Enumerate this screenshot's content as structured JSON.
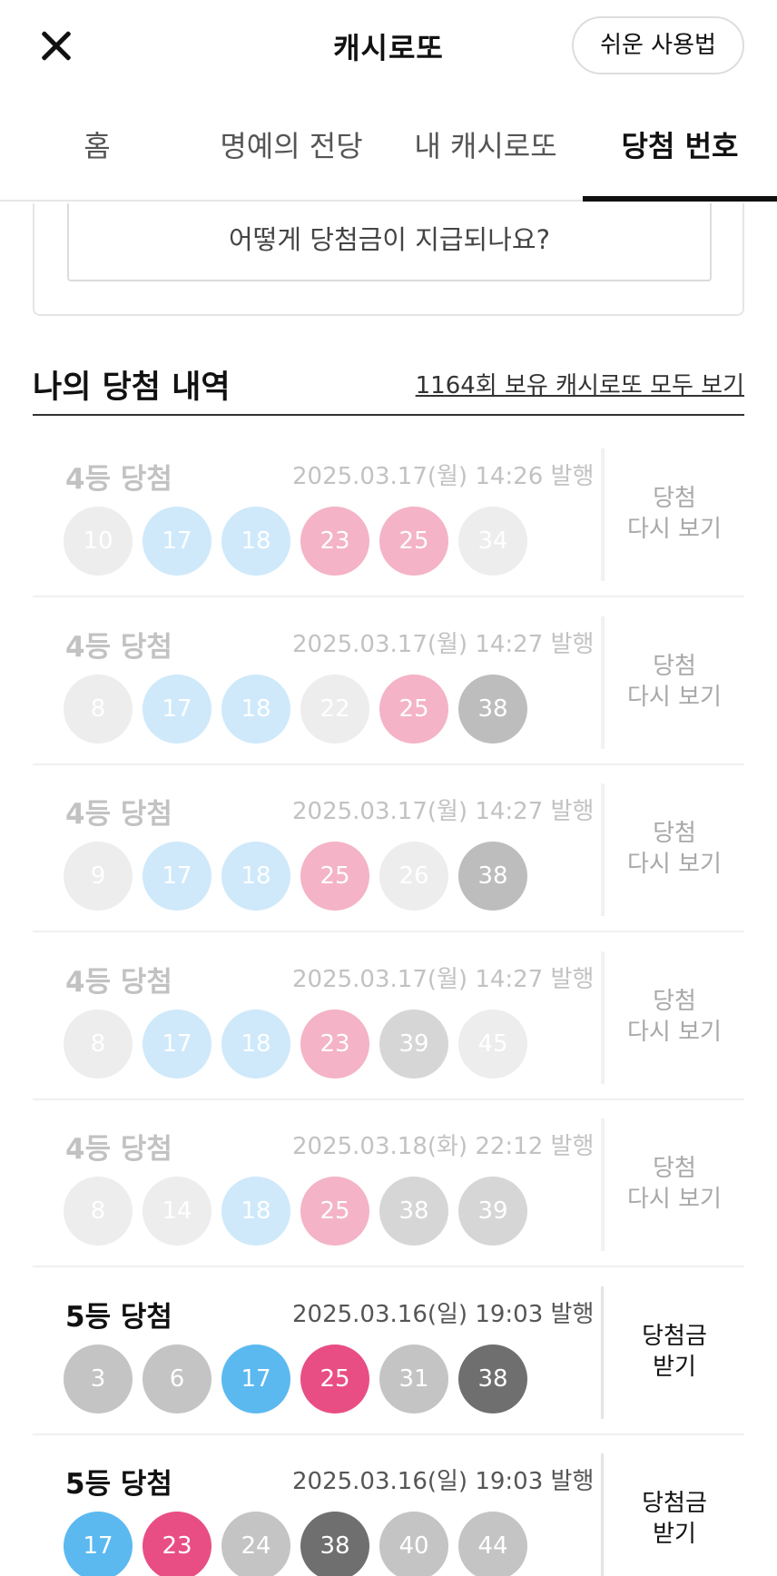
{
  "header": {
    "title": "캐시로또",
    "guide_label": "쉬운 사용법"
  },
  "tabs": [
    {
      "label": "홈",
      "active": false
    },
    {
      "label": "명예의 전당",
      "active": false
    },
    {
      "label": "내 캐시로또",
      "active": false
    },
    {
      "label": "당첨 번호",
      "active": true
    }
  ],
  "faq": {
    "label": "어떻게 당첨금이 지급되나요?"
  },
  "history": {
    "title": "나의 당첨 내역",
    "link": "1164회 보유 캐시로또 모두 보기",
    "rows": [
      {
        "rank": "4등 당첨",
        "date": "2025.03.17(월) 14:26 발행",
        "action": [
          "당첨",
          "다시 보기"
        ],
        "faded": true,
        "balls": [
          {
            "num": "10",
            "color": "#ededed"
          },
          {
            "num": "17",
            "color": "#cfe9fb"
          },
          {
            "num": "18",
            "color": "#cfe9fb"
          },
          {
            "num": "23",
            "color": "#f4b3c7"
          },
          {
            "num": "25",
            "color": "#f4b3c7"
          },
          {
            "num": "34",
            "color": "#ededed"
          }
        ]
      },
      {
        "rank": "4등 당첨",
        "date": "2025.03.17(월) 14:27 발행",
        "action": [
          "당첨",
          "다시 보기"
        ],
        "faded": true,
        "balls": [
          {
            "num": "8",
            "color": "#ededed"
          },
          {
            "num": "17",
            "color": "#cfe9fb"
          },
          {
            "num": "18",
            "color": "#cfe9fb"
          },
          {
            "num": "22",
            "color": "#ededed"
          },
          {
            "num": "25",
            "color": "#f4b3c7"
          },
          {
            "num": "38",
            "color": "#bdbdbd"
          }
        ]
      },
      {
        "rank": "4등 당첨",
        "date": "2025.03.17(월) 14:27 발행",
        "action": [
          "당첨",
          "다시 보기"
        ],
        "faded": true,
        "balls": [
          {
            "num": "9",
            "color": "#ededed"
          },
          {
            "num": "17",
            "color": "#cfe9fb"
          },
          {
            "num": "18",
            "color": "#cfe9fb"
          },
          {
            "num": "25",
            "color": "#f4b3c7"
          },
          {
            "num": "26",
            "color": "#ededed"
          },
          {
            "num": "38",
            "color": "#bdbdbd"
          }
        ]
      },
      {
        "rank": "4등 당첨",
        "date": "2025.03.17(월) 14:27 발행",
        "action": [
          "당첨",
          "다시 보기"
        ],
        "faded": true,
        "balls": [
          {
            "num": "8",
            "color": "#ededed"
          },
          {
            "num": "17",
            "color": "#cfe9fb"
          },
          {
            "num": "18",
            "color": "#cfe9fb"
          },
          {
            "num": "23",
            "color": "#f4b3c7"
          },
          {
            "num": "39",
            "color": "#d6d6d6"
          },
          {
            "num": "45",
            "color": "#ededed"
          }
        ]
      },
      {
        "rank": "4등 당첨",
        "date": "2025.03.18(화) 22:12 발행",
        "action": [
          "당첨",
          "다시 보기"
        ],
        "faded": true,
        "balls": [
          {
            "num": "8",
            "color": "#ededed"
          },
          {
            "num": "14",
            "color": "#ededed"
          },
          {
            "num": "18",
            "color": "#cfe9fb"
          },
          {
            "num": "25",
            "color": "#f4b3c7"
          },
          {
            "num": "38",
            "color": "#d6d6d6"
          },
          {
            "num": "39",
            "color": "#d6d6d6"
          }
        ]
      },
      {
        "rank": "5등 당첨",
        "date": "2025.03.16(일) 19:03 발행",
        "action": [
          "당첨금",
          "받기"
        ],
        "faded": false,
        "balls": [
          {
            "num": "3",
            "color": "#c4c4c4"
          },
          {
            "num": "6",
            "color": "#c4c4c4"
          },
          {
            "num": "17",
            "color": "#5bb9f0"
          },
          {
            "num": "25",
            "color": "#e84e83"
          },
          {
            "num": "31",
            "color": "#c4c4c4"
          },
          {
            "num": "38",
            "color": "#6f6f6f"
          }
        ]
      },
      {
        "rank": "5등 당첨",
        "date": "2025.03.16(일) 19:03 발행",
        "action": [
          "당첨금",
          "받기"
        ],
        "faded": false,
        "balls": [
          {
            "num": "17",
            "color": "#5bb9f0"
          },
          {
            "num": "23",
            "color": "#e84e83"
          },
          {
            "num": "24",
            "color": "#c4c4c4"
          },
          {
            "num": "38",
            "color": "#6f6f6f"
          },
          {
            "num": "40",
            "color": "#c4c4c4"
          },
          {
            "num": "44",
            "color": "#c4c4c4"
          }
        ]
      }
    ]
  }
}
